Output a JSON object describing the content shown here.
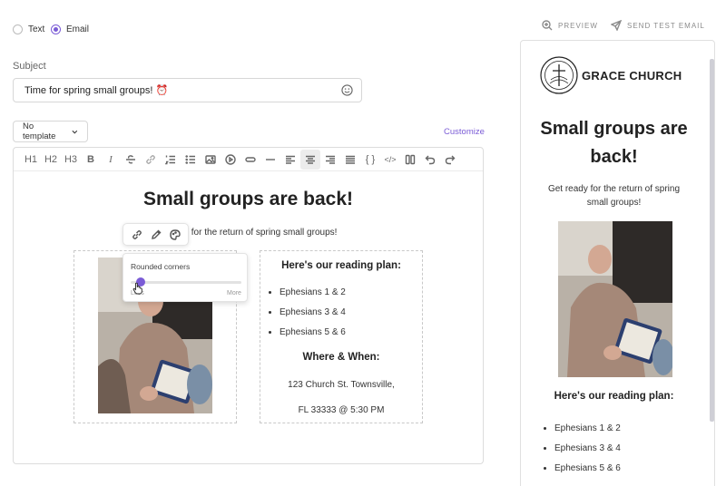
{
  "format": {
    "options": [
      {
        "label": "Text",
        "selected": false
      },
      {
        "label": "Email",
        "selected": true
      }
    ]
  },
  "subject": {
    "label": "Subject",
    "value": "Time for spring small groups! ⏰"
  },
  "template": {
    "selected": "No template",
    "customize_label": "Customize"
  },
  "toolbar": {
    "h1": "H1",
    "h2": "H2",
    "h3": "H3",
    "bold": "B",
    "italic": "I",
    "code_block": "{ }",
    "code": "</>"
  },
  "content": {
    "title": "Small groups are back!",
    "subtitle": "Get ready for the return of spring small groups!",
    "subtitle_visible": "y for the return of spring small groups!",
    "reading_heading": "Here's our reading plan:",
    "plan": [
      "Ephesians 1 & 2",
      "Ephesians 3 & 4",
      "Ephesians 5 & 6"
    ],
    "where_heading": "Where & When:",
    "address_line1": "123 Church St. Townsville,",
    "address_line2": "FL 33333 @ 5:30 PM"
  },
  "image_popover": {
    "title": "Rounded corners",
    "less": "Less",
    "more": "More",
    "value": 0.05
  },
  "actions": {
    "preview": "PREVIEW",
    "send_test": "SEND TEST EMAIL"
  },
  "preview": {
    "brand": "GRACE CHURCH",
    "title_line1": "Small groups are",
    "title_line2": "back!",
    "sub_line1": "Get ready for the return of spring",
    "sub_line2": "small groups!",
    "reading_heading": "Here's our reading plan:",
    "plan": [
      "Ephesians 1 & 2",
      "Ephesians 3 & 4",
      "Ephesians 5 & 6"
    ]
  },
  "colors": {
    "accent": "#7b5cd6"
  }
}
